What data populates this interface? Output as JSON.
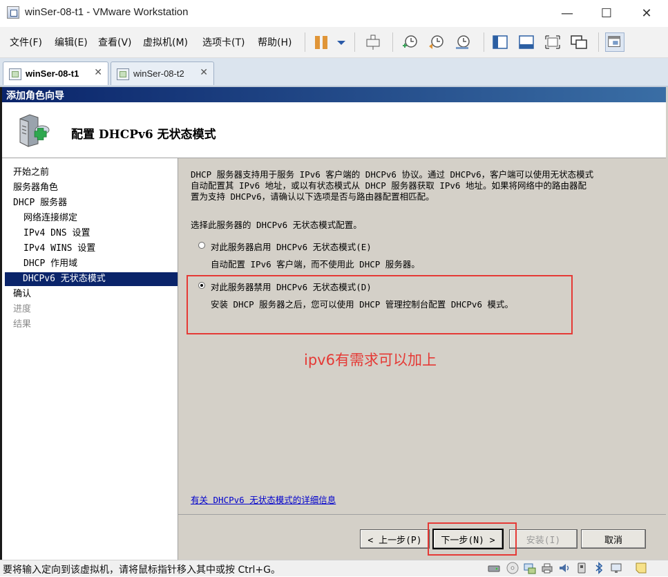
{
  "window": {
    "title": "winSer-08-t1 - VMware Workstation",
    "controls": {
      "minimize": "—",
      "maximize": "☐",
      "close": "✕"
    }
  },
  "menu": [
    "文件(F)",
    "编辑(E)",
    "查看(V)",
    "虚拟机(M)",
    "选项卡(T)",
    "帮助(H)"
  ],
  "toolbar": {
    "icons": [
      "pause-icon",
      "dropdown-icon",
      "send-ctrl-alt-del-icon",
      "snapshot-take-icon",
      "snapshot-revert-icon",
      "snapshot-manager-icon",
      "library-view-icon",
      "thumbnail-view-icon",
      "fullscreen-icon",
      "unity-icon",
      "console-view-icon"
    ]
  },
  "tabs": [
    {
      "label": "winSer-08-t1",
      "active": true,
      "close": "✕"
    },
    {
      "label": "winSer-08-t2",
      "active": false,
      "close": "✕"
    }
  ],
  "wizard": {
    "window_title": "添加角色向导",
    "heading": "配置 DHCPv6 无状态模式",
    "nav": [
      {
        "label": "开始之前",
        "level": 0,
        "state": "normal"
      },
      {
        "label": "服务器角色",
        "level": 0,
        "state": "normal"
      },
      {
        "label": "DHCP 服务器",
        "level": 0,
        "state": "normal"
      },
      {
        "label": "网络连接绑定",
        "level": 1,
        "state": "normal"
      },
      {
        "label": "IPv4 DNS 设置",
        "level": 1,
        "state": "normal"
      },
      {
        "label": "IPv4 WINS 设置",
        "level": 1,
        "state": "normal"
      },
      {
        "label": "DHCP 作用域",
        "level": 1,
        "state": "normal"
      },
      {
        "label": "DHCPv6 无状态模式",
        "level": 1,
        "state": "selected"
      },
      {
        "label": "确认",
        "level": 0,
        "state": "normal"
      },
      {
        "label": "进度",
        "level": 0,
        "state": "disabled"
      },
      {
        "label": "结果",
        "level": 0,
        "state": "disabled"
      }
    ],
    "description": "DHCP 服务器支持用于服务 IPv6 客户端的 DHCPv6 协议。通过 DHCPv6，客户端可以使用无状态模式\n自动配置其 IPv6 地址，或以有状态模式从 DHCP 服务器获取 IPv6 地址。如果将网络中的路由器配\n置为支持 DHCPv6，请确认以下选项是否与路由器配置相匹配。",
    "prompt": "选择此服务器的 DHCPv6 无状态模式配置。",
    "options": [
      {
        "label": "对此服务器启用 DHCPv6 无状态模式(E)",
        "sub": "自动配置 IPv6 客户端，而不使用此 DHCP 服务器。",
        "selected": false
      },
      {
        "label": "对此服务器禁用 DHCPv6 无状态模式(D)",
        "sub": "安装 DHCP 服务器之后，您可以使用 DHCP 管理控制台配置 DHCPv6 模式。",
        "selected": true
      }
    ],
    "detail_link": "有关 DHCPv6 无状态模式的详细信息",
    "buttons": {
      "back": "< 上一步(P)",
      "next": "下一步(N) >",
      "install": "安装(I)",
      "cancel": "取消"
    }
  },
  "annotation": "ipv6有需求可以加上",
  "statusbar": {
    "text": "要将输入定向到该虚拟机，请将鼠标指针移入其中或按 Ctrl+G。",
    "icons": [
      "hard-disk-icon",
      "cd-dvd-icon",
      "network-adapter-icon",
      "printer-icon",
      "sound-icon",
      "usb-icon",
      "bluetooth-icon",
      "display-icon",
      "message-icon"
    ]
  },
  "colors": {
    "wizard_title_bar": "#0a246a",
    "nav_selected": "#0a246a",
    "annotation_red": "#e53935",
    "guest_bg": "#d4d0c8"
  }
}
